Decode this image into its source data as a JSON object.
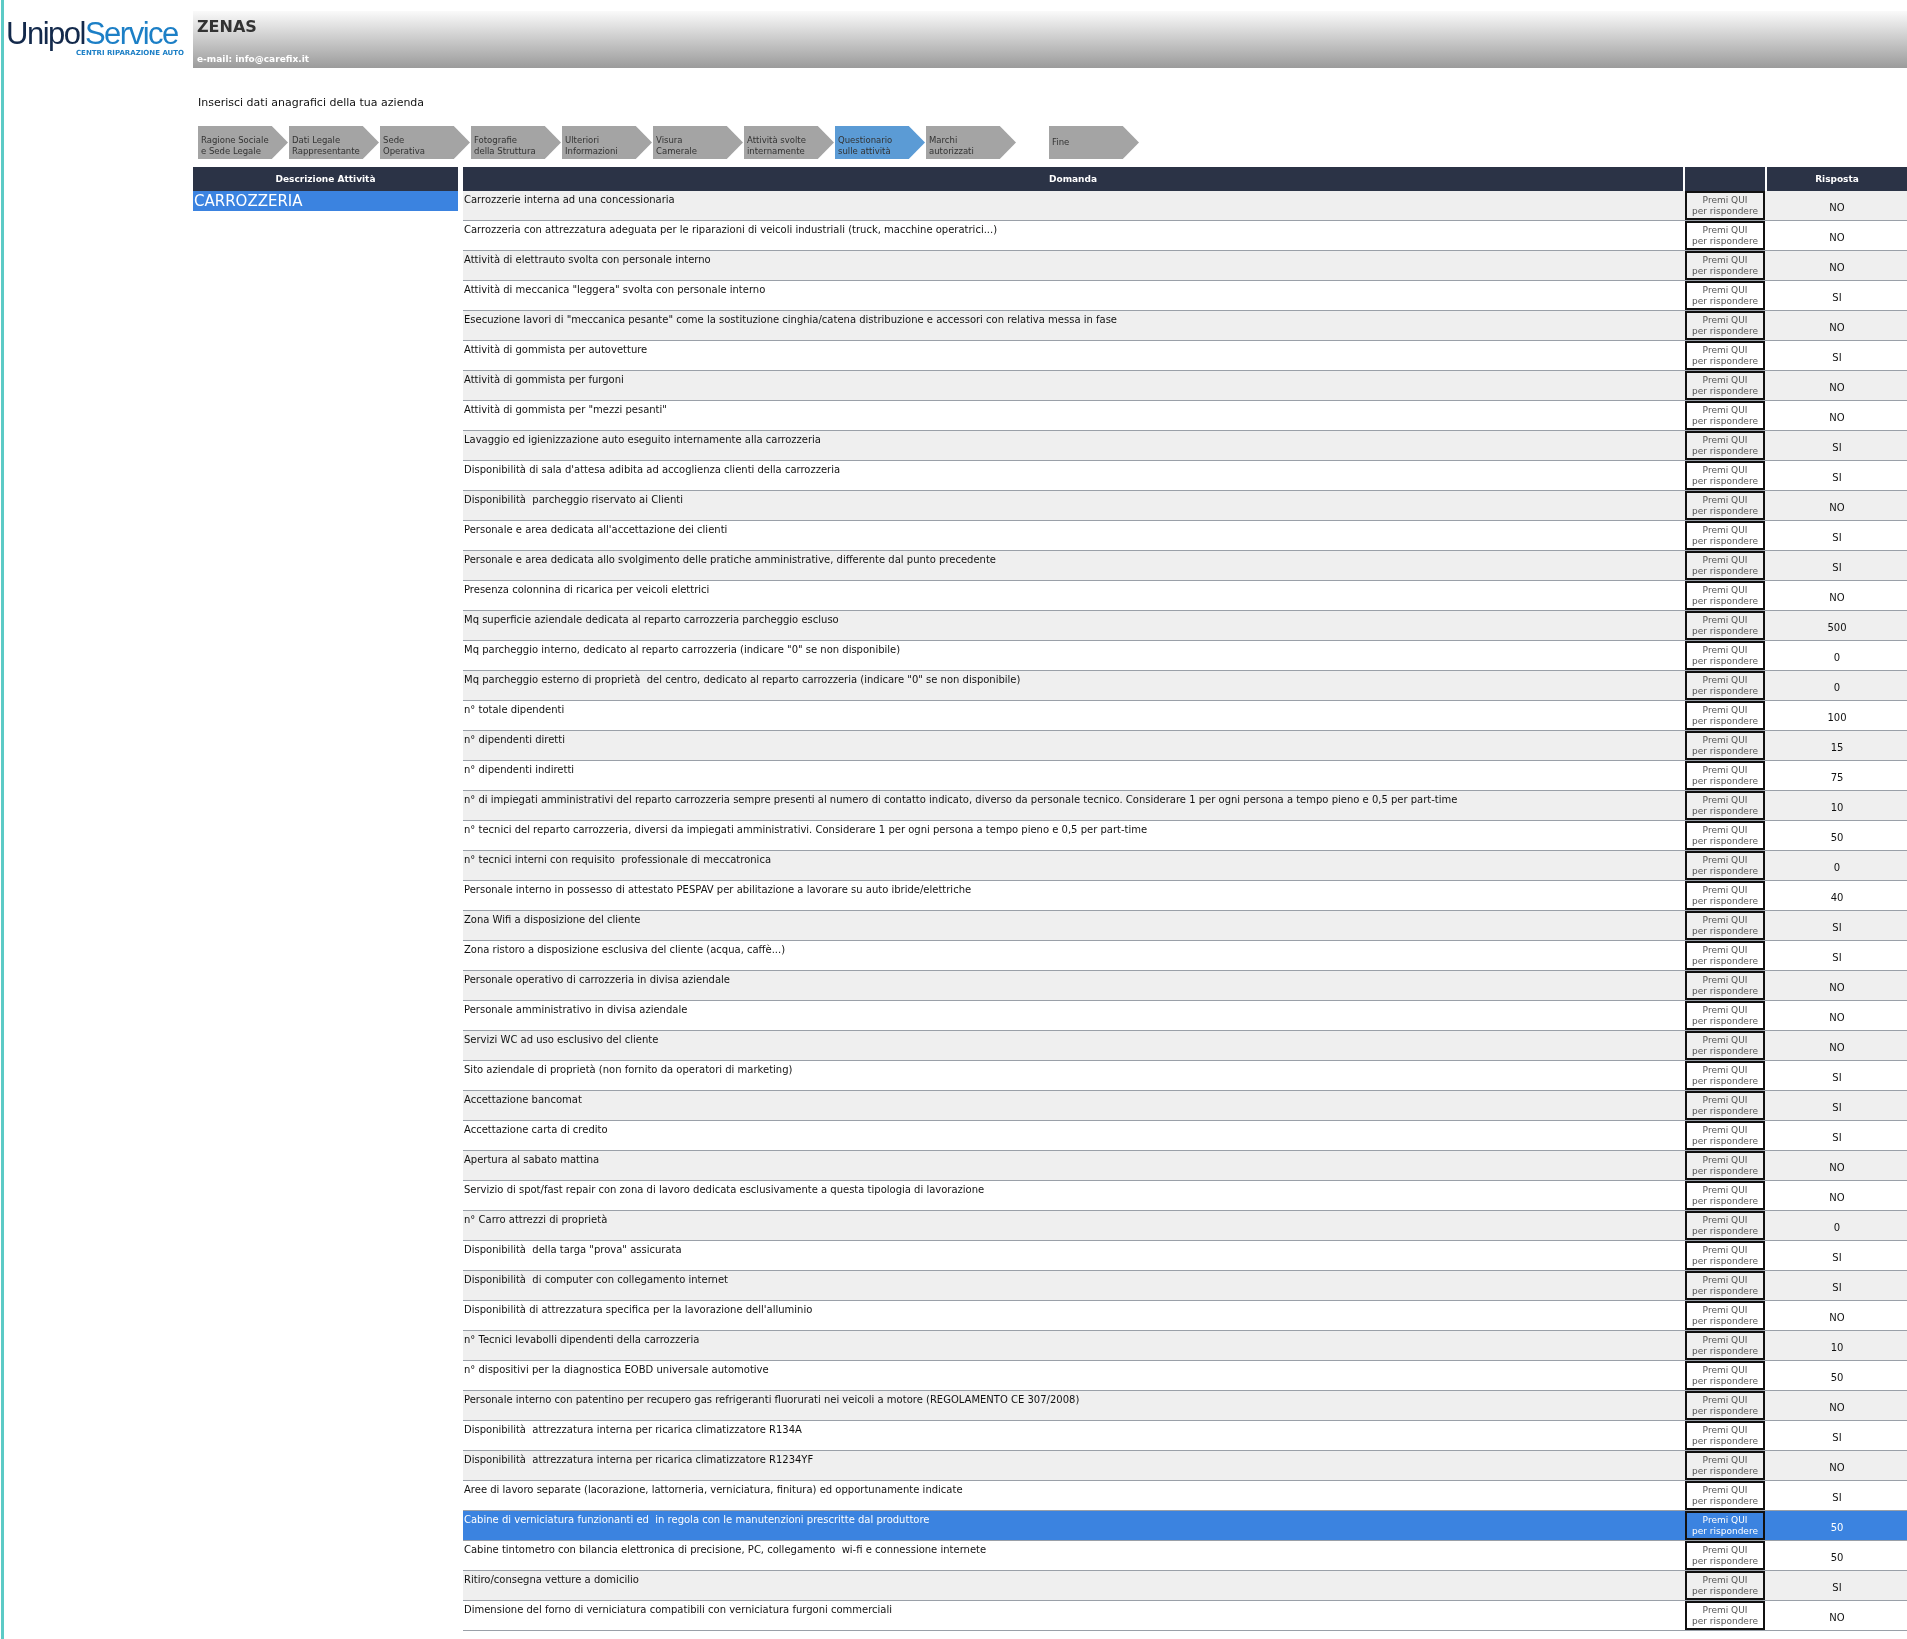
{
  "logo": {
    "brand_a": "Unipol",
    "brand_b": "Service",
    "tagline": "CENTRI RIPARAZIONE AUTO"
  },
  "header": {
    "company": "ZENAS",
    "email": "e-mail: info@carefix.it"
  },
  "intro": "Inserisci dati anagrafici della tua azienda",
  "steps": [
    {
      "label": "Ragione Sociale\ne Sede Legale",
      "selected": false
    },
    {
      "label": "Dati Legale\nRappresentante",
      "selected": false
    },
    {
      "label": "Sede\nOperativa",
      "selected": false
    },
    {
      "label": "Fotografie\ndella Struttura",
      "selected": false
    },
    {
      "label": "Ulteriori\nInformazioni",
      "selected": false
    },
    {
      "label": "Visura\nCamerale",
      "selected": false
    },
    {
      "label": "Attività svolte\ninternamente",
      "selected": false
    },
    {
      "label": "Questionario\nsulle attività",
      "selected": true
    },
    {
      "label": "Marchi\nautorizzati",
      "selected": false
    },
    {
      "label": "Fine",
      "selected": false
    }
  ],
  "sidebar": {
    "title": "Descrizione Attività",
    "items": [
      {
        "label": "CARROZZERIA",
        "selected": true
      }
    ]
  },
  "table": {
    "columns": [
      "Domanda",
      "Risposta"
    ],
    "rows": [
      {
        "question": "Carrozzerie interna ad una concessionaria",
        "button": "Premi QUI\nper rispondere",
        "answer": "NO",
        "selected": false
      },
      {
        "question": "Carrozzeria con attrezzatura adeguata per le riparazioni di veicoli industriali (truck, macchine operatrici...)",
        "button": "Premi QUI\nper rispondere",
        "answer": "NO",
        "selected": false
      },
      {
        "question": "Attività di elettrauto svolta con personale interno",
        "button": "Premi QUI\nper rispondere",
        "answer": "NO",
        "selected": false
      },
      {
        "question": "Attività di meccanica \"leggera\" svolta con personale interno",
        "button": "Premi QUI\nper rispondere",
        "answer": "SI",
        "selected": false
      },
      {
        "question": "Esecuzione lavori di \"meccanica pesante\" come la sostituzione cinghia/catena distribuzione e accessori con relativa messa in fase",
        "button": "Premi QUI\nper rispondere",
        "answer": "NO",
        "selected": false
      },
      {
        "question": "Attività di gommista per autovetture",
        "button": "Premi QUI\nper rispondere",
        "answer": "SI",
        "selected": false
      },
      {
        "question": "Attività di gommista per furgoni",
        "button": "Premi QUI\nper rispondere",
        "answer": "NO",
        "selected": false
      },
      {
        "question": "Attività di gommista per \"mezzi pesanti\"",
        "button": "Premi QUI\nper rispondere",
        "answer": "NO",
        "selected": false
      },
      {
        "question": "Lavaggio ed igienizzazione auto eseguito internamente alla carrozzeria",
        "button": "Premi QUI\nper rispondere",
        "answer": "SI",
        "selected": false
      },
      {
        "question": "Disponibilità di sala d'attesa adibita ad accoglienza clienti della carrozzeria",
        "button": "Premi QUI\nper rispondere",
        "answer": "SI",
        "selected": false
      },
      {
        "question": "Disponibilità  parcheggio riservato ai Clienti",
        "button": "Premi QUI\nper rispondere",
        "answer": "NO",
        "selected": false
      },
      {
        "question": "Personale e area dedicata all'accettazione dei clienti",
        "button": "Premi QUI\nper rispondere",
        "answer": "SI",
        "selected": false
      },
      {
        "question": "Personale e area dedicata allo svolgimento delle pratiche amministrative, differente dal punto precedente",
        "button": "Premi QUI\nper rispondere",
        "answer": "SI",
        "selected": false
      },
      {
        "question": "Presenza colonnina di ricarica per veicoli elettrici",
        "button": "Premi QUI\nper rispondere",
        "answer": "NO",
        "selected": false
      },
      {
        "question": "Mq superficie aziendale dedicata al reparto carrozzeria parcheggio escluso",
        "button": "Premi QUI\nper rispondere",
        "answer": "500",
        "selected": false
      },
      {
        "question": "Mq parcheggio interno, dedicato al reparto carrozzeria (indicare \"0\" se non disponibile)",
        "button": "Premi QUI\nper rispondere",
        "answer": "0",
        "selected": false
      },
      {
        "question": "Mq parcheggio esterno di proprietà  del centro, dedicato al reparto carrozzeria (indicare \"0\" se non disponibile)",
        "button": "Premi QUI\nper rispondere",
        "answer": "0",
        "selected": false
      },
      {
        "question": "n° totale dipendenti",
        "button": "Premi QUI\nper rispondere",
        "answer": "100",
        "selected": false
      },
      {
        "question": "n° dipendenti diretti",
        "button": "Premi QUI\nper rispondere",
        "answer": "15",
        "selected": false
      },
      {
        "question": "n° dipendenti indiretti",
        "button": "Premi QUI\nper rispondere",
        "answer": "75",
        "selected": false
      },
      {
        "question": "n° di impiegati amministrativi del reparto carrozzeria sempre presenti al numero di contatto indicato, diverso da personale tecnico. Considerare 1 per ogni persona a tempo pieno e 0,5 per part-time",
        "button": "Premi QUI\nper rispondere",
        "answer": "10",
        "selected": false
      },
      {
        "question": "n° tecnici del reparto carrozzeria, diversi da impiegati amministrativi. Considerare 1 per ogni persona a tempo pieno e 0,5 per part-time",
        "button": "Premi QUI\nper rispondere",
        "answer": "50",
        "selected": false
      },
      {
        "question": "n° tecnici interni con requisito  professionale di meccatronica",
        "button": "Premi QUI\nper rispondere",
        "answer": "0",
        "selected": false
      },
      {
        "question": "Personale interno in possesso di attestato PESPAV per abilitazione a lavorare su auto ibride/elettriche",
        "button": "Premi QUI\nper rispondere",
        "answer": "40",
        "selected": false
      },
      {
        "question": "Zona Wifi a disposizione del cliente",
        "button": "Premi QUI\nper rispondere",
        "answer": "SI",
        "selected": false
      },
      {
        "question": "Zona ristoro a disposizione esclusiva del cliente (acqua, caffè...)",
        "button": "Premi QUI\nper rispondere",
        "answer": "SI",
        "selected": false
      },
      {
        "question": "Personale operativo di carrozzeria in divisa aziendale",
        "button": "Premi QUI\nper rispondere",
        "answer": "NO",
        "selected": false
      },
      {
        "question": "Personale amministrativo in divisa aziendale",
        "button": "Premi QUI\nper rispondere",
        "answer": "NO",
        "selected": false
      },
      {
        "question": "Servizi WC ad uso esclusivo del cliente",
        "button": "Premi QUI\nper rispondere",
        "answer": "NO",
        "selected": false
      },
      {
        "question": "Sito aziendale di proprietà (non fornito da operatori di marketing)",
        "button": "Premi QUI\nper rispondere",
        "answer": "SI",
        "selected": false
      },
      {
        "question": "Accettazione bancomat",
        "button": "Premi QUI\nper rispondere",
        "answer": "SI",
        "selected": false
      },
      {
        "question": "Accettazione carta di credito",
        "button": "Premi QUI\nper rispondere",
        "answer": "SI",
        "selected": false
      },
      {
        "question": "Apertura al sabato mattina",
        "button": "Premi QUI\nper rispondere",
        "answer": "NO",
        "selected": false
      },
      {
        "question": "Servizio di spot/fast repair con zona di lavoro dedicata esclusivamente a questa tipologia di lavorazione",
        "button": "Premi QUI\nper rispondere",
        "answer": "NO",
        "selected": false
      },
      {
        "question": "n° Carro attrezzi di proprietà",
        "button": "Premi QUI\nper rispondere",
        "answer": "0",
        "selected": false
      },
      {
        "question": "Disponibilità  della targa \"prova\" assicurata",
        "button": "Premi QUI\nper rispondere",
        "answer": "SI",
        "selected": false
      },
      {
        "question": "Disponibilità  di computer con collegamento internet",
        "button": "Premi QUI\nper rispondere",
        "answer": "SI",
        "selected": false
      },
      {
        "question": "Disponibilità di attrezzatura specifica per la lavorazione dell'alluminio",
        "button": "Premi QUI\nper rispondere",
        "answer": "NO",
        "selected": false
      },
      {
        "question": "n° Tecnici levabolli dipendenti della carrozzeria",
        "button": "Premi QUI\nper rispondere",
        "answer": "10",
        "selected": false
      },
      {
        "question": "n° dispositivi per la diagnostica EOBD universale automotive",
        "button": "Premi QUI\nper rispondere",
        "answer": "50",
        "selected": false
      },
      {
        "question": "Personale interno con patentino per recupero gas refrigeranti fluorurati nei veicoli a motore (REGOLAMENTO CE 307/2008)",
        "button": "Premi QUI\nper rispondere",
        "answer": "NO",
        "selected": false
      },
      {
        "question": "Disponibilità  attrezzatura interna per ricarica climatizzatore R134A",
        "button": "Premi QUI\nper rispondere",
        "answer": "SI",
        "selected": false
      },
      {
        "question": "Disponibilità  attrezzatura interna per ricarica climatizzatore R1234YF",
        "button": "Premi QUI\nper rispondere",
        "answer": "NO",
        "selected": false
      },
      {
        "question": "Aree di lavoro separate (lacorazione, lattorneria, verniciatura, finitura) ed opportunamente indicate",
        "button": "Premi QUI\nper rispondere",
        "answer": "SI",
        "selected": false
      },
      {
        "question": "Cabine di verniciatura funzionanti ed  in regola con le manutenzioni prescritte dal produttore",
        "button": "Premi QUI\nper rispondere",
        "answer": "50",
        "selected": true
      },
      {
        "question": "Cabine tintometro con bilancia elettronica di precisione, PC, collegamento  wi-fi e connessione internete",
        "button": "Premi QUI\nper rispondere",
        "answer": "50",
        "selected": false
      },
      {
        "question": "Ritiro/consegna vetture a domicilio",
        "button": "Premi QUI\nper rispondere",
        "answer": "SI",
        "selected": false
      },
      {
        "question": "Dimensione del forno di verniciatura compatibili con verniciatura furgoni commerciali",
        "button": "Premi QUI\nper rispondere",
        "answer": "NO",
        "selected": false
      }
    ]
  }
}
